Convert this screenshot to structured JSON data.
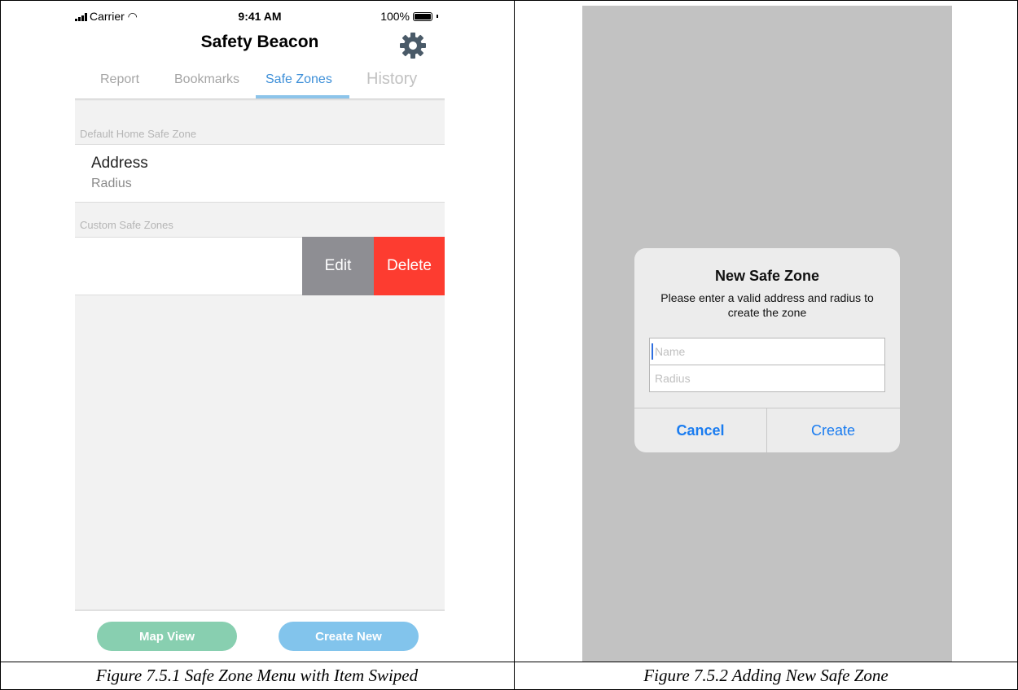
{
  "left_phone": {
    "status_bar": {
      "carrier": "Carrier",
      "time": "9:41 AM",
      "battery": "100%"
    },
    "nav": {
      "title": "Safety Beacon",
      "settings_icon": "gear-icon"
    },
    "tabs": [
      {
        "label": "Report",
        "active": false
      },
      {
        "label": "Bookmarks",
        "active": false
      },
      {
        "label": "Safe Zones",
        "active": true
      },
      {
        "label": "History",
        "active": false
      }
    ],
    "sections": {
      "default_header": "Default Home Safe Zone",
      "default_item": {
        "title": "Address",
        "subtitle": "Radius"
      },
      "custom_header": "Custom Safe Zones",
      "swipe_actions": {
        "edit": "Edit",
        "delete": "Delete"
      }
    },
    "buttons": {
      "map_view": "Map View",
      "create_new": "Create New"
    },
    "colors": {
      "accent": "#3d8fd8",
      "delete": "#fd3c30",
      "edit": "#8e8e93",
      "map_button": "#88cfb0",
      "create_button": "#82c4ec"
    }
  },
  "right_phone": {
    "dialog": {
      "title": "New Safe Zone",
      "message": "Please enter a valid address and radius to create the zone",
      "name_placeholder": "Name",
      "radius_placeholder": "Radius",
      "cancel": "Cancel",
      "create": "Create"
    },
    "colors": {
      "overlay": "#c2c2c2",
      "button_text": "#1a7cf0"
    }
  },
  "captions": {
    "left": "Figure 7.5.1 Safe Zone Menu with Item Swiped",
    "right": "Figure 7.5.2 Adding New Safe Zone"
  }
}
